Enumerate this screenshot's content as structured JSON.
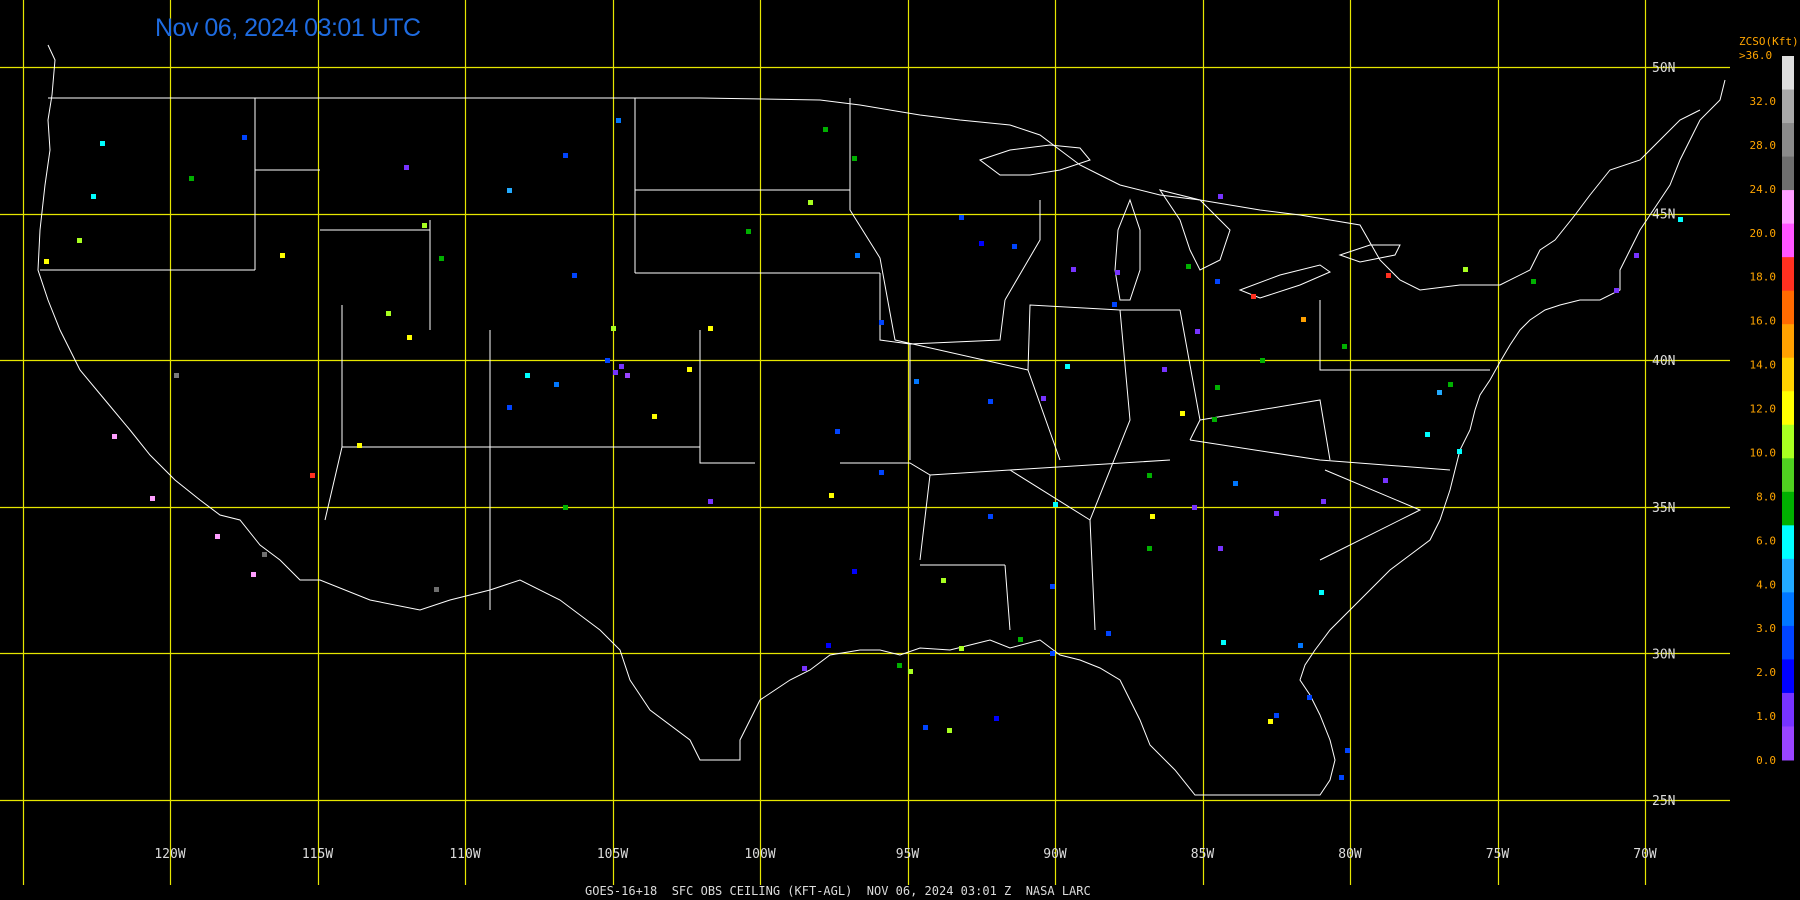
{
  "title": "Nov 06, 2024 03:01 UTC",
  "footer": "GOES-16+18  SFC OBS CEILING (KFT-AGL)  NOV 06, 2024 03:01 Z  NASA LARC",
  "legend": {
    "title": "ZCSO(Kft)",
    "top_label": ">36.0",
    "labels": [
      "32.0",
      "28.0",
      "24.0",
      "20.0",
      "18.0",
      "16.0",
      "14.0",
      "12.0",
      "10.0",
      "8.0",
      "6.0",
      "4.0",
      "3.0",
      "2.0",
      "1.0",
      "0.0"
    ],
    "colors": [
      "#dcdcdc",
      "#a8a8a8",
      "#8a8a8a",
      "#6e6e6e",
      "#ff9eff",
      "#ff55ff",
      "#ff3020",
      "#ff6a00",
      "#ffa000",
      "#ffd200",
      "#ffff00",
      "#a8ff20",
      "#50d020",
      "#00b000",
      "#00ffff",
      "#22aaff",
      "#0077ff",
      "#0044ff",
      "#0000ff",
      "#7733ff",
      "#9944ff"
    ]
  },
  "lon_labels": [
    "120W",
    "115W",
    "110W",
    "105W",
    "100W",
    "95W",
    "90W",
    "85W",
    "80W",
    "75W",
    "70W"
  ],
  "lat_labels": [
    "50N",
    "45N",
    "40N",
    "35N",
    "30N",
    "25N"
  ],
  "colors": {
    "grid": "#e6e600",
    "boundary": "#ffffff",
    "background": "#000000",
    "title": "#1e6be0",
    "legend_text": "#ffa500"
  },
  "observations": [
    {
      "lon": -122.3,
      "lat": 47.4,
      "c": "#00ffff"
    },
    {
      "lon": -122.6,
      "lat": 45.6,
      "c": "#00ffff"
    },
    {
      "lon": -123.1,
      "lat": 44.1,
      "c": "#a8ff20"
    },
    {
      "lon": -124.2,
      "lat": 43.4,
      "c": "#ffff00"
    },
    {
      "lon": -119.3,
      "lat": 46.2,
      "c": "#00b000"
    },
    {
      "lon": -117.5,
      "lat": 47.6,
      "c": "#0044ff"
    },
    {
      "lon": -116.2,
      "lat": 43.6,
      "c": "#ffff00"
    },
    {
      "lon": -112.0,
      "lat": 46.6,
      "c": "#7733ff"
    },
    {
      "lon": -108.5,
      "lat": 45.8,
      "c": "#22aaff"
    },
    {
      "lon": -106.6,
      "lat": 47.0,
      "c": "#0044ff"
    },
    {
      "lon": -104.8,
      "lat": 48.2,
      "c": "#0077ff"
    },
    {
      "lon": -111.4,
      "lat": 44.6,
      "c": "#a8ff20"
    },
    {
      "lon": -110.8,
      "lat": 43.5,
      "c": "#00b000"
    },
    {
      "lon": -106.3,
      "lat": 42.9,
      "c": "#0044ff"
    },
    {
      "lon": -105.0,
      "lat": 41.1,
      "c": "#a8ff20"
    },
    {
      "lon": -104.7,
      "lat": 39.8,
      "c": "#7733ff"
    },
    {
      "lon": -104.5,
      "lat": 39.5,
      "c": "#9944ff"
    },
    {
      "lon": -104.9,
      "lat": 39.6,
      "c": "#7733ff"
    },
    {
      "lon": -105.2,
      "lat": 40.0,
      "c": "#0044ff"
    },
    {
      "lon": -106.9,
      "lat": 39.2,
      "c": "#0077ff"
    },
    {
      "lon": -107.9,
      "lat": 39.5,
      "c": "#00ffff"
    },
    {
      "lon": -108.5,
      "lat": 38.4,
      "c": "#0044ff"
    },
    {
      "lon": -103.6,
      "lat": 38.1,
      "c": "#ffff00"
    },
    {
      "lon": -102.4,
      "lat": 39.7,
      "c": "#ffff00"
    },
    {
      "lon": -111.9,
      "lat": 40.8,
      "c": "#ffff00"
    },
    {
      "lon": -112.6,
      "lat": 41.6,
      "c": "#a8ff20"
    },
    {
      "lon": -113.6,
      "lat": 37.1,
      "c": "#ffff00"
    },
    {
      "lon": -115.2,
      "lat": 36.1,
      "c": "#ff3020"
    },
    {
      "lon": -119.8,
      "lat": 39.5,
      "c": "#7a7a7a"
    },
    {
      "lon": -118.4,
      "lat": 34.0,
      "c": "#ff9eff"
    },
    {
      "lon": -120.6,
      "lat": 35.3,
      "c": "#ff9eff"
    },
    {
      "lon": -121.9,
      "lat": 37.4,
      "c": "#ff9eff"
    },
    {
      "lon": -117.2,
      "lat": 32.7,
      "c": "#ff9eff"
    },
    {
      "lon": -116.8,
      "lat": 33.4,
      "c": "#6e6e6e"
    },
    {
      "lon": -111.0,
      "lat": 32.2,
      "c": "#6e6e6e"
    },
    {
      "lon": -101.7,
      "lat": 41.1,
      "c": "#ffff00"
    },
    {
      "lon": -97.8,
      "lat": 47.9,
      "c": "#00b000"
    },
    {
      "lon": -96.8,
      "lat": 46.9,
      "c": "#00b000"
    },
    {
      "lon": -98.3,
      "lat": 45.4,
      "c": "#a8ff20"
    },
    {
      "lon": -96.7,
      "lat": 43.6,
      "c": "#0077ff"
    },
    {
      "lon": -100.4,
      "lat": 44.4,
      "c": "#00b000"
    },
    {
      "lon": -95.9,
      "lat": 41.3,
      "c": "#0044ff"
    },
    {
      "lon": -93.2,
      "lat": 44.9,
      "c": "#0044ff"
    },
    {
      "lon": -92.5,
      "lat": 44.0,
      "c": "#0000ff"
    },
    {
      "lon": -91.4,
      "lat": 43.9,
      "c": "#0044ff"
    },
    {
      "lon": -89.4,
      "lat": 43.1,
      "c": "#7733ff"
    },
    {
      "lon": -87.9,
      "lat": 43.0,
      "c": "#7733ff"
    },
    {
      "lon": -88.0,
      "lat": 41.9,
      "c": "#0044ff"
    },
    {
      "lon": -89.6,
      "lat": 39.8,
      "c": "#00ffff"
    },
    {
      "lon": -86.3,
      "lat": 39.7,
      "c": "#7733ff"
    },
    {
      "lon": -85.2,
      "lat": 41.0,
      "c": "#7733ff"
    },
    {
      "lon": -84.5,
      "lat": 42.7,
      "c": "#0044ff"
    },
    {
      "lon": -83.3,
      "lat": 42.2,
      "c": "#ff3020"
    },
    {
      "lon": -85.5,
      "lat": 43.2,
      "c": "#00b000"
    },
    {
      "lon": -84.4,
      "lat": 45.6,
      "c": "#7733ff"
    },
    {
      "lon": -83.0,
      "lat": 40.0,
      "c": "#00b000"
    },
    {
      "lon": -84.5,
      "lat": 39.1,
      "c": "#00b000"
    },
    {
      "lon": -81.6,
      "lat": 41.4,
      "c": "#ffa000"
    },
    {
      "lon": -80.2,
      "lat": 40.5,
      "c": "#00b000"
    },
    {
      "lon": -78.7,
      "lat": 42.9,
      "c": "#ff3020"
    },
    {
      "lon": -76.1,
      "lat": 43.1,
      "c": "#a8ff20"
    },
    {
      "lon": -73.8,
      "lat": 42.7,
      "c": "#00b000"
    },
    {
      "lon": -71.0,
      "lat": 42.4,
      "c": "#7733ff"
    },
    {
      "lon": -70.3,
      "lat": 43.6,
      "c": "#7733ff"
    },
    {
      "lon": -68.8,
      "lat": 44.8,
      "c": "#00ffff"
    },
    {
      "lon": -77.0,
      "lat": 38.9,
      "c": "#22aaff"
    },
    {
      "lon": -76.6,
      "lat": 39.2,
      "c": "#00b000"
    },
    {
      "lon": -77.4,
      "lat": 37.5,
      "c": "#00ffff"
    },
    {
      "lon": -76.3,
      "lat": 36.9,
      "c": "#00ffff"
    },
    {
      "lon": -78.8,
      "lat": 35.9,
      "c": "#7733ff"
    },
    {
      "lon": -80.9,
      "lat": 35.2,
      "c": "#7733ff"
    },
    {
      "lon": -82.5,
      "lat": 34.8,
      "c": "#7733ff"
    },
    {
      "lon": -84.4,
      "lat": 33.6,
      "c": "#7733ff"
    },
    {
      "lon": -81.0,
      "lat": 32.1,
      "c": "#00ffff"
    },
    {
      "lon": -81.7,
      "lat": 30.3,
      "c": "#0077ff"
    },
    {
      "lon": -82.5,
      "lat": 27.9,
      "c": "#0044ff"
    },
    {
      "lon": -82.7,
      "lat": 27.7,
      "c": "#ffff00"
    },
    {
      "lon": -81.4,
      "lat": 28.5,
      "c": "#0044ff"
    },
    {
      "lon": -80.3,
      "lat": 25.8,
      "c": "#0044ff"
    },
    {
      "lon": -80.1,
      "lat": 26.7,
      "c": "#0044ff"
    },
    {
      "lon": -84.3,
      "lat": 30.4,
      "c": "#00ffff"
    },
    {
      "lon": -86.8,
      "lat": 33.6,
      "c": "#00b000"
    },
    {
      "lon": -88.2,
      "lat": 30.7,
      "c": "#0044ff"
    },
    {
      "lon": -90.1,
      "lat": 32.3,
      "c": "#0044ff"
    },
    {
      "lon": -90.1,
      "lat": 30.0,
      "c": "#0044ff"
    },
    {
      "lon": -91.2,
      "lat": 30.5,
      "c": "#00b000"
    },
    {
      "lon": -93.2,
      "lat": 30.2,
      "c": "#a8ff20"
    },
    {
      "lon": -95.3,
      "lat": 29.6,
      "c": "#00b000"
    },
    {
      "lon": -94.9,
      "lat": 29.4,
      "c": "#a8ff20"
    },
    {
      "lon": -97.7,
      "lat": 30.3,
      "c": "#0000ff"
    },
    {
      "lon": -94.4,
      "lat": 27.5,
      "c": "#0044ff"
    },
    {
      "lon": -93.6,
      "lat": 27.4,
      "c": "#a8ff20"
    },
    {
      "lon": -92.0,
      "lat": 27.8,
      "c": "#0000ff"
    },
    {
      "lon": -93.8,
      "lat": 32.5,
      "c": "#a8ff20"
    },
    {
      "lon": -92.2,
      "lat": 34.7,
      "c": "#0044ff"
    },
    {
      "lon": -90.0,
      "lat": 35.1,
      "c": "#00ffff"
    },
    {
      "lon": -86.8,
      "lat": 36.1,
      "c": "#00b000"
    },
    {
      "lon": -85.3,
      "lat": 35.0,
      "c": "#7733ff"
    },
    {
      "lon": -83.9,
      "lat": 35.8,
      "c": "#0077ff"
    },
    {
      "lon": -86.7,
      "lat": 34.7,
      "c": "#ffff00"
    },
    {
      "lon": -85.7,
      "lat": 38.2,
      "c": "#ffff00"
    },
    {
      "lon": -84.6,
      "lat": 38.0,
      "c": "#00b000"
    },
    {
      "lon": -90.4,
      "lat": 38.7,
      "c": "#7733ff"
    },
    {
      "lon": -94.7,
      "lat": 39.3,
      "c": "#0077ff"
    },
    {
      "lon": -92.2,
      "lat": 38.6,
      "c": "#0044ff"
    },
    {
      "lon": -97.4,
      "lat": 37.6,
      "c": "#0044ff"
    },
    {
      "lon": -97.6,
      "lat": 35.4,
      "c": "#ffff00"
    },
    {
      "lon": -95.9,
      "lat": 36.2,
      "c": "#0044ff"
    },
    {
      "lon": -96.8,
      "lat": 32.8,
      "c": "#0000ff"
    },
    {
      "lon": -101.7,
      "lat": 35.2,
      "c": "#7733ff"
    },
    {
      "lon": -106.6,
      "lat": 35.0,
      "c": "#00b000"
    },
    {
      "lon": -98.5,
      "lat": 29.5,
      "c": "#7733ff"
    }
  ]
}
